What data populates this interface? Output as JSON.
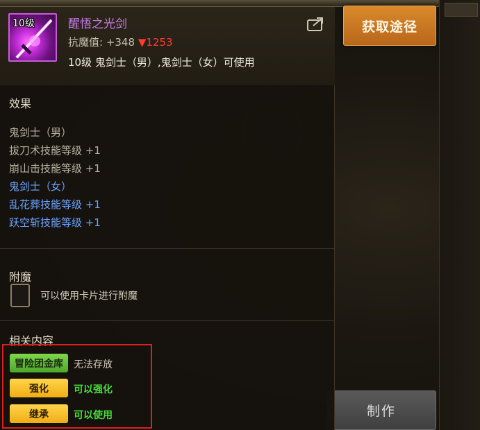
{
  "header": {
    "item_level": "10级",
    "item_name": "醒悟之光剑",
    "anti_magic_label": "抗魔值: +348",
    "anti_magic_down": "▼1253",
    "usable_by": "10级 鬼剑士（男）,鬼剑士（女）可使用",
    "share_icon": "share-icon"
  },
  "get_path_button": "获取途径",
  "make_button": "制作",
  "effects": {
    "title": "效果",
    "male_header": "鬼剑士（男）",
    "male_lines": [
      "拔刀术技能等级 +1",
      "崩山击技能等级 +1"
    ],
    "female_header": "鬼剑士（女）",
    "female_lines": [
      "乱花葬技能等级 +1",
      "跃空斩技能等级 +1"
    ]
  },
  "enchant": {
    "title": "附魔",
    "text": "可以使用卡片进行附魔"
  },
  "related": {
    "title": "相关内容",
    "rows": [
      {
        "tag": "冒险团金库",
        "value": "无法存放",
        "tag_color": "#6ec43f",
        "value_color": "#d8d0c0"
      },
      {
        "tag": "强化",
        "value": "可以强化",
        "tag_color": "#f7c12a",
        "value_color": "#47e03a"
      },
      {
        "tag": "继承",
        "value": "可以使用",
        "tag_color": "#f7c12a",
        "value_color": "#47e03a"
      }
    ]
  },
  "colors": {
    "item_name": "#c678e6",
    "anti_magic_down": "#ff3b30",
    "female_effect": "#6ba4ff",
    "highlight_border": "#e11d1d",
    "get_path_button": "#c9781f"
  }
}
